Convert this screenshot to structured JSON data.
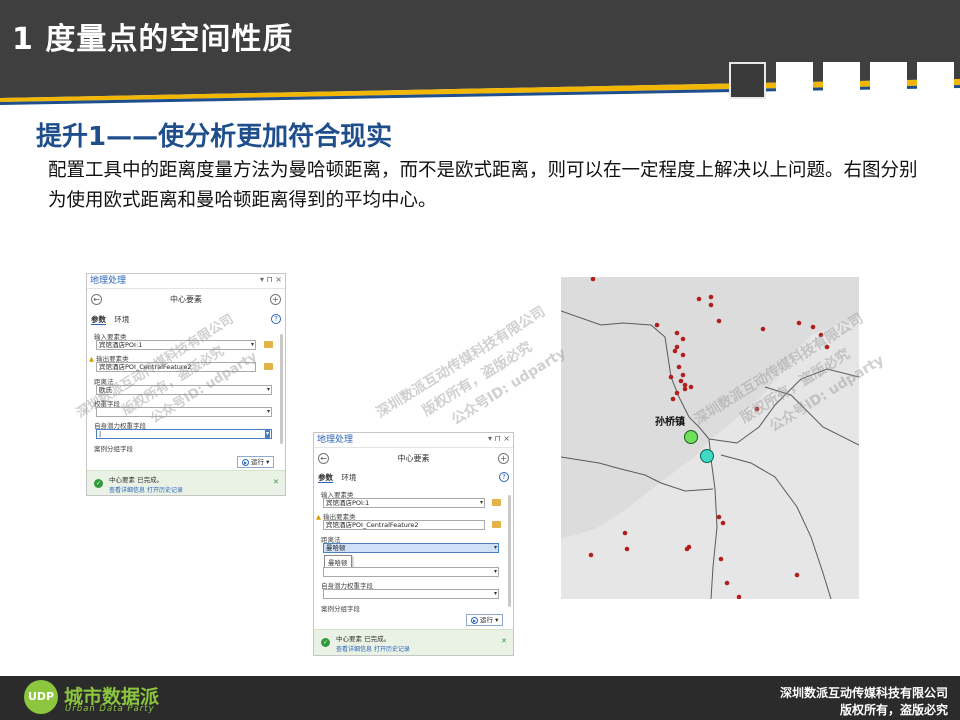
{
  "header": {
    "title": "1 度量点的空间性质",
    "nav_squares": 5
  },
  "subtitle": "提升1——使分析更加符合现实",
  "paragraph": "配置工具中的距离度量方法为曼哈顿距离，而不是欧式距离，则可以在一定程度上解决以上问题。右图分别为使用欧式距离和曼哈顿距离得到的平均中心。",
  "panel_euclid": {
    "title": "地理处理",
    "window_controls": "▾ ⊓ ×",
    "back_icon": "←",
    "add_icon": "+",
    "tool_name": "中心要素",
    "tab_params": "参数",
    "tab_env": "环境",
    "help_icon": "?",
    "label_input": "输入要素类",
    "value_input": "宾馆酒店POI:1",
    "label_output": "输出要素类",
    "value_output": "宾馆酒店POI_CentralFeature2",
    "label_distance": "距离法",
    "value_distance": "欧氏",
    "label_weight": "权重字段",
    "value_weight": "",
    "label_self": "自身潜力权重字段",
    "value_self": "|",
    "label_case": "案例分组字段",
    "run_label": "运行",
    "status_text": "中心要素 已完成。",
    "status_link1": "查看详细信息",
    "status_link2": "打开历史记录"
  },
  "panel_manhattan": {
    "title": "地理处理",
    "window_controls": "▾ ⊓ ×",
    "back_icon": "←",
    "add_icon": "+",
    "tool_name": "中心要素",
    "tab_params": "参数",
    "tab_env": "环境",
    "help_icon": "?",
    "label_input": "输入要素类",
    "value_input": "宾馆酒店POI:1",
    "label_output": "输出要素类",
    "value_output": "宾馆酒店POI_CentralFeature2",
    "label_distance": "距离法",
    "value_distance": "曼哈顿",
    "popup_option": "曼哈顿",
    "label_weight": "自身潜力权重字段",
    "label_case": "案例分组字段",
    "run_label": "运行",
    "status_text": "中心要素 已完成。",
    "status_link1": "查看详细信息",
    "status_link2": "打开历史记录"
  },
  "map": {
    "town_label": "孙桥镇",
    "poi_color": "#b01e1e",
    "euclid_center_color": "#6fe05a",
    "manhattan_center_color": "#3ddbc6"
  },
  "watermark": {
    "line1": "深圳数派互动传媒科技有限公司",
    "line2": "版权所有，盗版必究",
    "line3": "公众号ID: udparty"
  },
  "footer": {
    "logo_badge": "UDP",
    "logo_cn": "城市数据派",
    "logo_en": "Urban Data Party",
    "company": "深圳数派互动传媒科技有限公司",
    "rights": "版权所有，盗版必究"
  },
  "colors": {
    "header_bg": "#3f3f3f",
    "stripe_yellow": "#f2b705",
    "stripe_blue": "#1f4e8c",
    "subtitle": "#1f4e8c",
    "logo_green": "#8cc63f"
  }
}
